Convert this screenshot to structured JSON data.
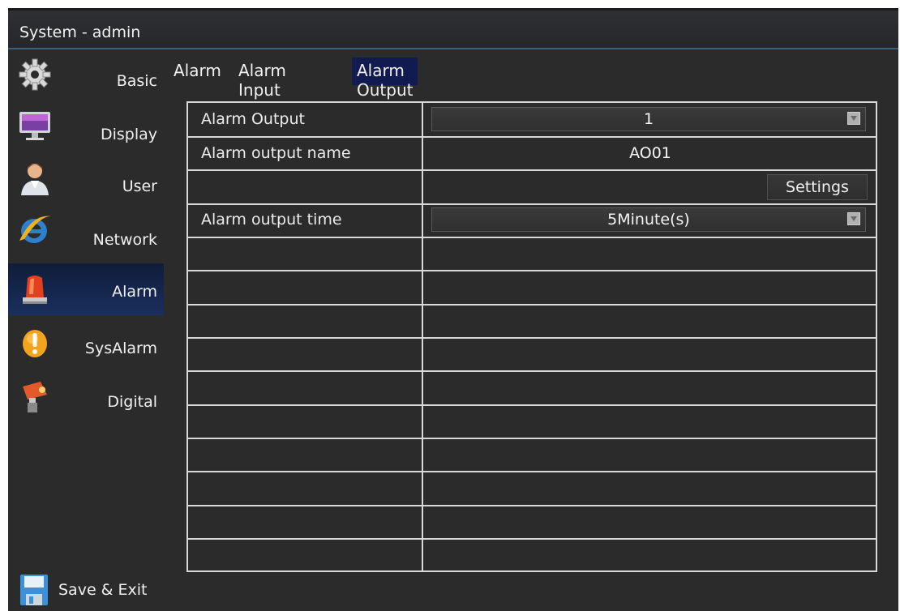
{
  "window": {
    "title": "System - admin"
  },
  "sidebar": {
    "items": [
      {
        "label": "Basic",
        "icon": "gear-icon"
      },
      {
        "label": "Display",
        "icon": "monitor-icon"
      },
      {
        "label": "User",
        "icon": "user-icon"
      },
      {
        "label": "Network",
        "icon": "network-icon"
      },
      {
        "label": "Alarm",
        "icon": "alarm-light-icon"
      },
      {
        "label": "SysAlarm",
        "icon": "warning-icon"
      },
      {
        "label": "Digital",
        "icon": "digital-camera-icon"
      }
    ],
    "active": "Alarm",
    "save_exit": {
      "label": "Save & Exit",
      "icon": "floppy-disk-icon"
    }
  },
  "tabs": [
    {
      "label": "Alarm"
    },
    {
      "label": "Alarm Input"
    },
    {
      "label": "Alarm Output"
    }
  ],
  "active_tab": "Alarm Output",
  "form": {
    "alarm_output": {
      "label": "Alarm Output",
      "value": "1"
    },
    "alarm_output_name": {
      "label": "Alarm output name",
      "value": "AO01"
    },
    "settings_button": "Settings",
    "alarm_output_time": {
      "label": "Alarm output time",
      "value": "5Minute(s)"
    }
  },
  "colors": {
    "active_item_bg": "#1b2f5e",
    "active_tab_bg": "#121a52",
    "panel_bg": "#2b2b2b",
    "grid_line": "#d8d8d8"
  }
}
